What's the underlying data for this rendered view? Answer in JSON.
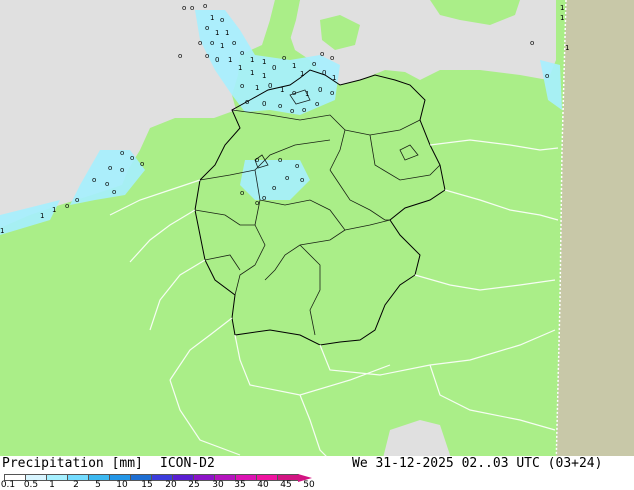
{
  "map": {
    "land_color": "#aaee88",
    "sea_color": "#e0e0e0",
    "outside_domain_color": "#c8c8a8",
    "border_color": "#000000",
    "precip_color": "#a6f0ff"
  },
  "footer": {
    "title": "Precipitation [mm]",
    "model": "ICON-D2",
    "datetime": "We 31-12-2025 02..03 UTC (03+24)"
  },
  "legend": {
    "ticks": [
      "0.1",
      "0.5",
      "1",
      "2",
      "5",
      "10",
      "15",
      "20",
      "25",
      "30",
      "35",
      "40",
      "45",
      "50"
    ],
    "colors": [
      "#ffffff",
      "#d8f5ff",
      "#a6f0ff",
      "#74dcff",
      "#3cb8f0",
      "#2496e6",
      "#1e6ed2",
      "#3c3cdc",
      "#5a1ed2",
      "#8c14c8",
      "#b414be",
      "#dc14b4",
      "#f014a0",
      "#d21482"
    ]
  }
}
